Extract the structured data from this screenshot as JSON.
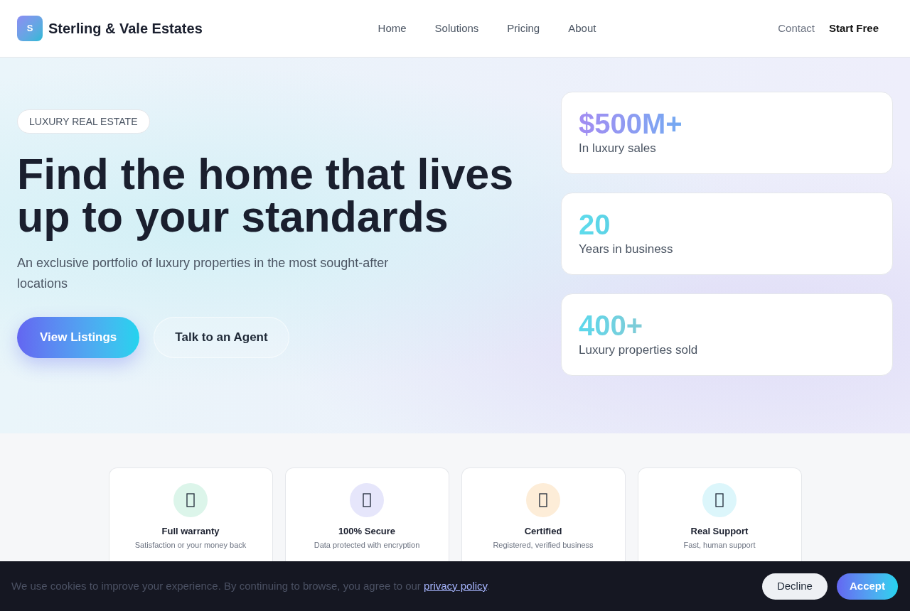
{
  "brand": {
    "logo_letter": "S",
    "name": "Sterling & Vale Estates"
  },
  "nav": {
    "links": [
      "Home",
      "Solutions",
      "Pricing",
      "About"
    ],
    "actions": [
      {
        "label": "Contact",
        "kind": "link"
      },
      {
        "label": "Start Free",
        "kind": "cta"
      }
    ]
  },
  "hero": {
    "badge": "LUXURY REAL ESTATE",
    "title": "Find the home that lives up to your standards",
    "subtitle": "An exclusive portfolio of luxury properties in the most sought-after locations",
    "buttons": [
      {
        "label": "View Listings",
        "kind": "primary"
      },
      {
        "label": "Talk to an Agent",
        "kind": "secondary"
      }
    ]
  },
  "stats": [
    {
      "value": "$500M+",
      "label": "In luxury sales"
    },
    {
      "value": "20",
      "label": "Years in business"
    },
    {
      "value": "400+",
      "label": "Luxury properties sold"
    }
  ],
  "features": [
    {
      "title": "Full warranty",
      "description": "Satisfaction or your money back",
      "color": "#dcf5ea"
    },
    {
      "title": "100% Secure",
      "description": "Data protected with encryption",
      "color": "#e6e6fb"
    },
    {
      "title": "Certified",
      "description": "Registered, verified business",
      "color": "#fdedd8"
    },
    {
      "title": "Real Support",
      "description": "Fast, human support",
      "color": "#dcf6fb"
    }
  ],
  "cookie_banner": {
    "text": "We use cookies to improve your experience. By continuing to browse, you agree to our",
    "link": "privacy policy",
    "end": ".",
    "buttons": [
      {
        "label": "Decline",
        "kind": "secondary"
      },
      {
        "label": "Accept",
        "kind": "primary"
      }
    ]
  }
}
